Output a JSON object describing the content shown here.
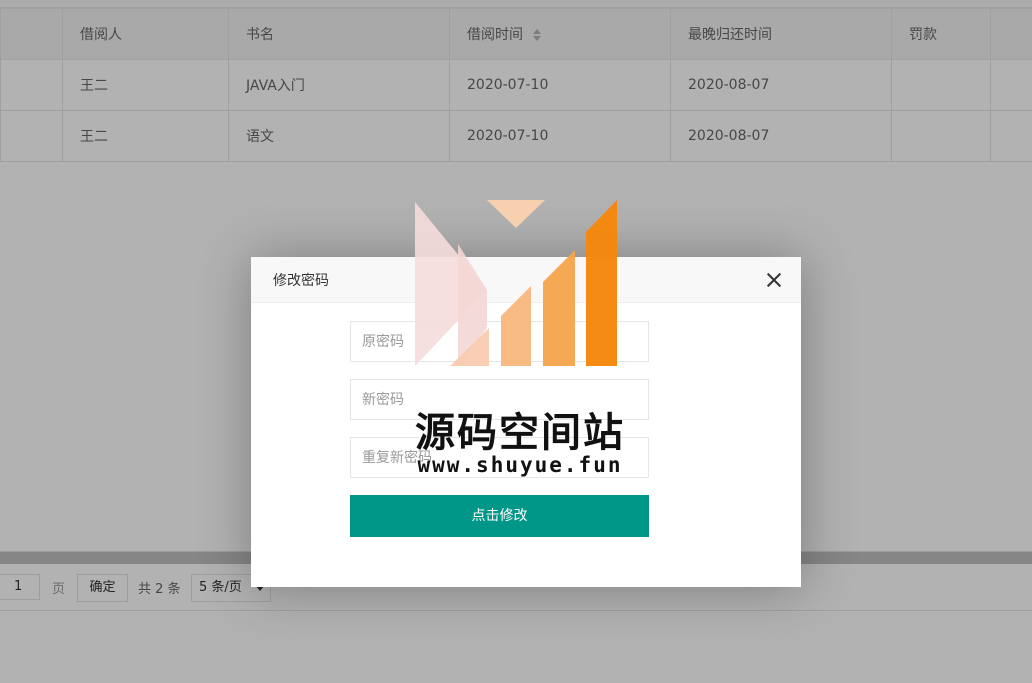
{
  "table": {
    "columns": [
      "",
      "借阅人",
      "书名",
      "借阅时间",
      "最晚归还时间",
      "罚款",
      ""
    ],
    "rows": [
      [
        "",
        "王二",
        "JAVA入门",
        "2020-07-10",
        "2020-08-07",
        "",
        ""
      ],
      [
        "",
        "王二",
        "语文",
        "2020-07-10",
        "2020-08-07",
        "",
        ""
      ]
    ]
  },
  "pagination": {
    "page_value": "1",
    "page_unit": "页",
    "go_label": "确定",
    "total_label": "共 2 条",
    "page_size": "5 条/页"
  },
  "dialog": {
    "title": "修改密码",
    "old_password_placeholder": "原密码",
    "new_password_placeholder": "新密码",
    "repeat_password_placeholder": "重复新密码",
    "submit_label": "点击修改"
  },
  "watermark": {
    "title": "源码空间站",
    "url": "www.shuyue.fun"
  },
  "colors": {
    "primary_button": "#009688",
    "shade": "rgba(0,0,0,0.3)"
  },
  "icons": [
    "sort-icon",
    "close-icon",
    "caret-down-icon"
  ]
}
